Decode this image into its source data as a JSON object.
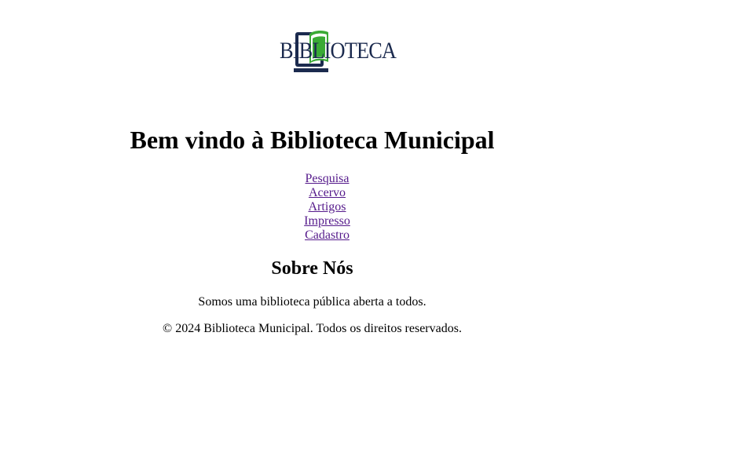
{
  "header": {
    "logo_text": "BIBLIOTECA",
    "logo_colors": {
      "book": "#3aaa35",
      "monitor": "#1b2a4e"
    }
  },
  "main": {
    "welcome_title": "Bem vindo à Biblioteca Municipal"
  },
  "nav": {
    "items": [
      {
        "label": "Pesquisa"
      },
      {
        "label": "Acervo"
      },
      {
        "label": "Artigos"
      },
      {
        "label": "Impresso"
      },
      {
        "label": "Cadastro"
      }
    ]
  },
  "about": {
    "heading": "Sobre Nós",
    "text": "Somos uma biblioteca pública aberta a todos."
  },
  "footer": {
    "text": "© 2024 Biblioteca Municipal. Todos os direitos reservados."
  }
}
